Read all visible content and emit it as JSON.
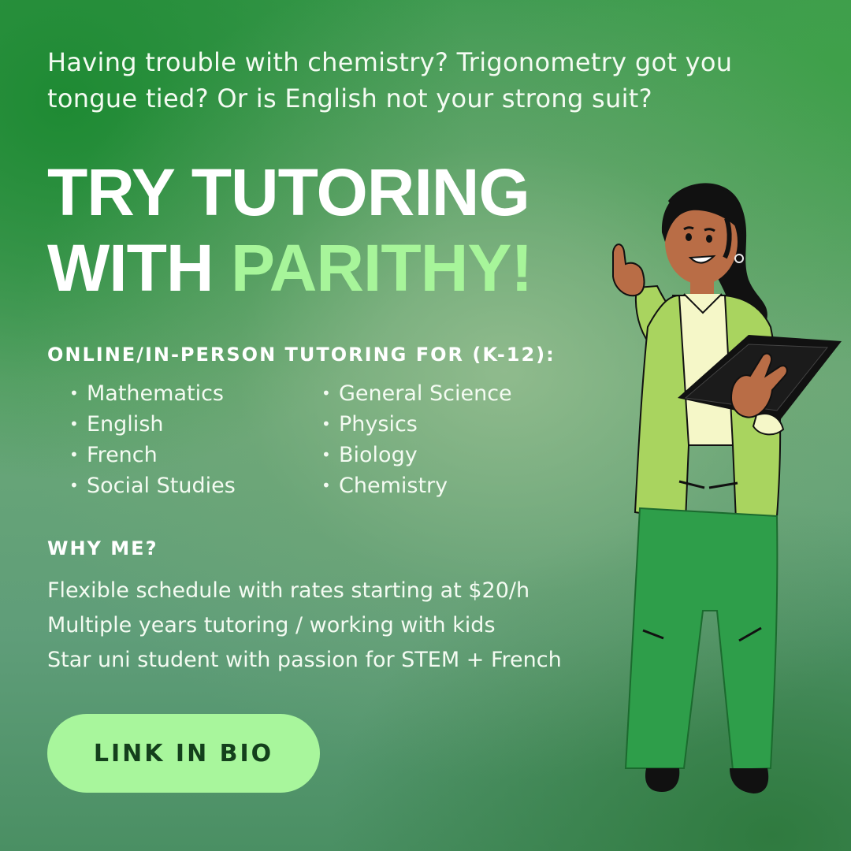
{
  "intro_text": "Having trouble with chemistry? Trigonometry got you tongue tied? Or is English not your strong suit?",
  "headline": {
    "line1": "TRY TUTORING",
    "line2_plain": "WITH ",
    "line2_accent": "PARITHY!"
  },
  "subjects": {
    "heading": "ONLINE/IN-PERSON TUTORING FOR (K-12):",
    "left": [
      {
        "label": "Mathematics"
      },
      {
        "label": "English"
      },
      {
        "label": "French"
      },
      {
        "label": "Social Studies"
      }
    ],
    "right": [
      {
        "label": "General Science"
      },
      {
        "label": "Physics"
      },
      {
        "label": "Biology"
      },
      {
        "label": "Chemistry"
      }
    ],
    "bullet": "•"
  },
  "why": {
    "heading": "WHY ME?",
    "reasons": [
      {
        "text": "Flexible schedule with rates starting at $20/h"
      },
      {
        "text": "Multiple years tutoring / working with kids"
      },
      {
        "text": "Star uni student with passion for STEM + French"
      }
    ]
  },
  "cta": {
    "label": "LINK IN BIO"
  },
  "colors": {
    "accent": "#a7f59a",
    "button_bg": "#a8f69c",
    "button_text": "#14401c",
    "text": "#ffffff"
  },
  "illustration": {
    "icon": "tutor-woman-with-book-illustration"
  }
}
